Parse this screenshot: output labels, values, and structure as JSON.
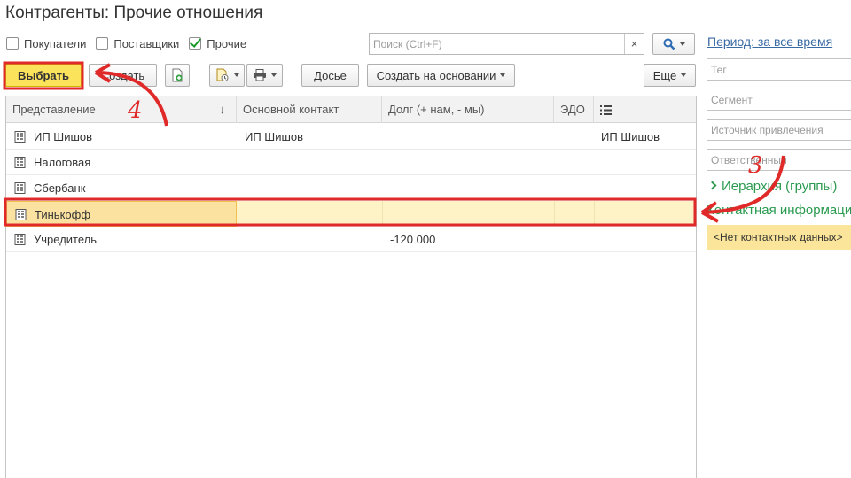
{
  "window": {
    "title": "Контрагенты: Прочие отношения"
  },
  "filters": [
    {
      "label": "Покупатели",
      "checked": false
    },
    {
      "label": "Поставщики",
      "checked": false
    },
    {
      "label": "Прочие",
      "checked": true
    }
  ],
  "search": {
    "placeholder": "Поиск (Ctrl+F)",
    "value": "",
    "clear_glyph": "×"
  },
  "toolbar": {
    "select_label": "Выбрать",
    "create_label": "Создать",
    "dossier_label": "Досье",
    "create_based_label": "Создать на основании",
    "more_label": "Еще"
  },
  "table": {
    "columns": [
      "Представление",
      "Основной контакт",
      "Долг (+ нам, - мы)",
      "ЭДО"
    ],
    "sort_indicator": "↓",
    "rows": [
      {
        "name": "ИП Шишов",
        "contact": "ИП Шишов",
        "debt": "",
        "edo": "",
        "extra": "ИП Шишов"
      },
      {
        "name": "Налоговая",
        "contact": "",
        "debt": "",
        "edo": "",
        "extra": ""
      },
      {
        "name": "Сбербанк",
        "contact": "",
        "debt": "",
        "edo": "",
        "extra": ""
      },
      {
        "name": "Тинькофф",
        "contact": "",
        "debt": "",
        "edo": "",
        "extra": "",
        "selected": true
      },
      {
        "name": "Учредитель",
        "contact": "",
        "debt": "-120 000",
        "edo": "",
        "extra": ""
      }
    ]
  },
  "side": {
    "period_label": "Период: за все время",
    "tag_placeholder": "Тег",
    "segment_placeholder": "Сегмент",
    "source_placeholder": "Источник привлечения",
    "responsible_placeholder": "Ответственный",
    "hierarchy_label": "Иерархия (группы)",
    "contact_title": "Контактная информация",
    "contact_empty": "<Нет контактных данных>"
  },
  "annotations": {
    "step_select": "4",
    "step_contact": "3",
    "color": "#e02a2a"
  },
  "colors": {
    "accent_yellow": "#fbe45c",
    "selection": "#fdf3c6",
    "link": "#3a6aa3",
    "green": "#2a9a4f"
  }
}
